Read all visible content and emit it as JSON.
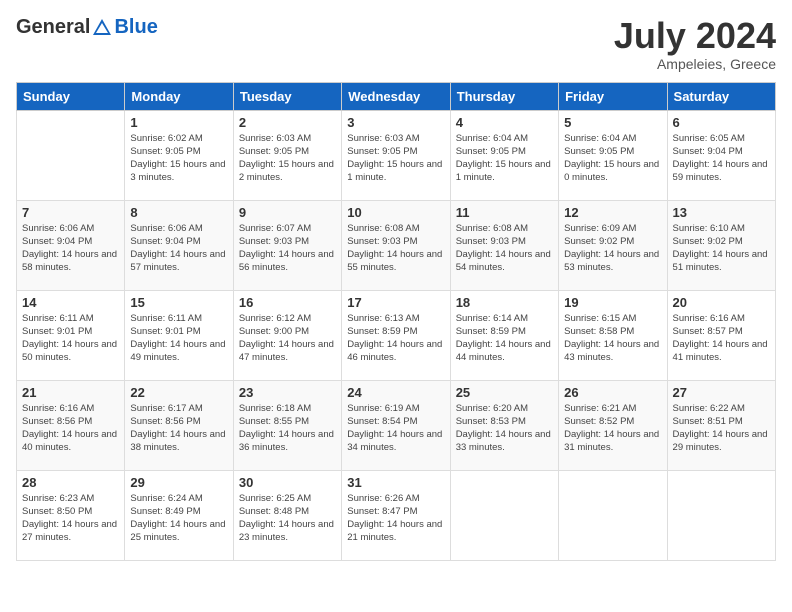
{
  "header": {
    "logo_general": "General",
    "logo_blue": "Blue",
    "month_year": "July 2024",
    "location": "Ampeleies, Greece"
  },
  "days_of_week": [
    "Sunday",
    "Monday",
    "Tuesday",
    "Wednesday",
    "Thursday",
    "Friday",
    "Saturday"
  ],
  "weeks": [
    [
      {
        "day": "",
        "sunrise": "",
        "sunset": "",
        "daylight": ""
      },
      {
        "day": "1",
        "sunrise": "6:02 AM",
        "sunset": "9:05 PM",
        "daylight": "15 hours and 3 minutes."
      },
      {
        "day": "2",
        "sunrise": "6:03 AM",
        "sunset": "9:05 PM",
        "daylight": "15 hours and 2 minutes."
      },
      {
        "day": "3",
        "sunrise": "6:03 AM",
        "sunset": "9:05 PM",
        "daylight": "15 hours and 1 minute."
      },
      {
        "day": "4",
        "sunrise": "6:04 AM",
        "sunset": "9:05 PM",
        "daylight": "15 hours and 1 minute."
      },
      {
        "day": "5",
        "sunrise": "6:04 AM",
        "sunset": "9:05 PM",
        "daylight": "15 hours and 0 minutes."
      },
      {
        "day": "6",
        "sunrise": "6:05 AM",
        "sunset": "9:04 PM",
        "daylight": "14 hours and 59 minutes."
      }
    ],
    [
      {
        "day": "7",
        "sunrise": "6:06 AM",
        "sunset": "9:04 PM",
        "daylight": "14 hours and 58 minutes."
      },
      {
        "day": "8",
        "sunrise": "6:06 AM",
        "sunset": "9:04 PM",
        "daylight": "14 hours and 57 minutes."
      },
      {
        "day": "9",
        "sunrise": "6:07 AM",
        "sunset": "9:03 PM",
        "daylight": "14 hours and 56 minutes."
      },
      {
        "day": "10",
        "sunrise": "6:08 AM",
        "sunset": "9:03 PM",
        "daylight": "14 hours and 55 minutes."
      },
      {
        "day": "11",
        "sunrise": "6:08 AM",
        "sunset": "9:03 PM",
        "daylight": "14 hours and 54 minutes."
      },
      {
        "day": "12",
        "sunrise": "6:09 AM",
        "sunset": "9:02 PM",
        "daylight": "14 hours and 53 minutes."
      },
      {
        "day": "13",
        "sunrise": "6:10 AM",
        "sunset": "9:02 PM",
        "daylight": "14 hours and 51 minutes."
      }
    ],
    [
      {
        "day": "14",
        "sunrise": "6:11 AM",
        "sunset": "9:01 PM",
        "daylight": "14 hours and 50 minutes."
      },
      {
        "day": "15",
        "sunrise": "6:11 AM",
        "sunset": "9:01 PM",
        "daylight": "14 hours and 49 minutes."
      },
      {
        "day": "16",
        "sunrise": "6:12 AM",
        "sunset": "9:00 PM",
        "daylight": "14 hours and 47 minutes."
      },
      {
        "day": "17",
        "sunrise": "6:13 AM",
        "sunset": "8:59 PM",
        "daylight": "14 hours and 46 minutes."
      },
      {
        "day": "18",
        "sunrise": "6:14 AM",
        "sunset": "8:59 PM",
        "daylight": "14 hours and 44 minutes."
      },
      {
        "day": "19",
        "sunrise": "6:15 AM",
        "sunset": "8:58 PM",
        "daylight": "14 hours and 43 minutes."
      },
      {
        "day": "20",
        "sunrise": "6:16 AM",
        "sunset": "8:57 PM",
        "daylight": "14 hours and 41 minutes."
      }
    ],
    [
      {
        "day": "21",
        "sunrise": "6:16 AM",
        "sunset": "8:56 PM",
        "daylight": "14 hours and 40 minutes."
      },
      {
        "day": "22",
        "sunrise": "6:17 AM",
        "sunset": "8:56 PM",
        "daylight": "14 hours and 38 minutes."
      },
      {
        "day": "23",
        "sunrise": "6:18 AM",
        "sunset": "8:55 PM",
        "daylight": "14 hours and 36 minutes."
      },
      {
        "day": "24",
        "sunrise": "6:19 AM",
        "sunset": "8:54 PM",
        "daylight": "14 hours and 34 minutes."
      },
      {
        "day": "25",
        "sunrise": "6:20 AM",
        "sunset": "8:53 PM",
        "daylight": "14 hours and 33 minutes."
      },
      {
        "day": "26",
        "sunrise": "6:21 AM",
        "sunset": "8:52 PM",
        "daylight": "14 hours and 31 minutes."
      },
      {
        "day": "27",
        "sunrise": "6:22 AM",
        "sunset": "8:51 PM",
        "daylight": "14 hours and 29 minutes."
      }
    ],
    [
      {
        "day": "28",
        "sunrise": "6:23 AM",
        "sunset": "8:50 PM",
        "daylight": "14 hours and 27 minutes."
      },
      {
        "day": "29",
        "sunrise": "6:24 AM",
        "sunset": "8:49 PM",
        "daylight": "14 hours and 25 minutes."
      },
      {
        "day": "30",
        "sunrise": "6:25 AM",
        "sunset": "8:48 PM",
        "daylight": "14 hours and 23 minutes."
      },
      {
        "day": "31",
        "sunrise": "6:26 AM",
        "sunset": "8:47 PM",
        "daylight": "14 hours and 21 minutes."
      },
      {
        "day": "",
        "sunrise": "",
        "sunset": "",
        "daylight": ""
      },
      {
        "day": "",
        "sunrise": "",
        "sunset": "",
        "daylight": ""
      },
      {
        "day": "",
        "sunrise": "",
        "sunset": "",
        "daylight": ""
      }
    ]
  ],
  "labels": {
    "sunrise_prefix": "Sunrise: ",
    "sunset_prefix": "Sunset: ",
    "daylight_prefix": "Daylight: "
  }
}
